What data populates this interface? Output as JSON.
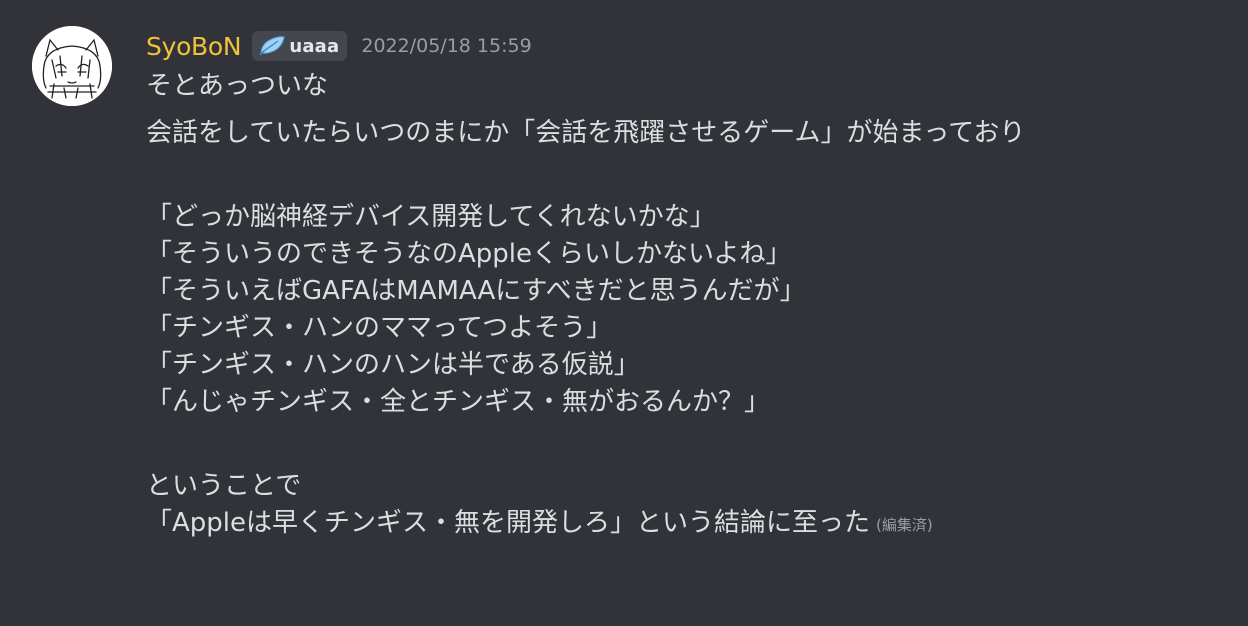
{
  "message": {
    "author": {
      "username": "SyoBoN",
      "username_color": "#f0c23c",
      "tag_icon": "feather-icon",
      "tag_text": "uaaa",
      "avatar": "avatar-sketch"
    },
    "timestamp": "2022/05/18 15:59",
    "lines": [
      "そとあっついな",
      "会話をしていたらいつのまにか「会話を飛躍させるゲーム」が始まっており",
      "「どっか脳神経デバイス開発してくれないかな」",
      "「そういうのできそうなのAppleくらいしかないよね」",
      "「そういえばGAFAはMAMAAにすべきだと思うんだが」",
      "「チンギス・ハンのママってつよそう」",
      "「チンギス・ハンのハンは半である仮説」",
      "「んじゃチンギス・全とチンギス・無がおるんか？」",
      "ということで",
      "「Appleは早くチンギス・無を開発しろ」という結論に至った"
    ],
    "edited_label": "(編集済)"
  }
}
